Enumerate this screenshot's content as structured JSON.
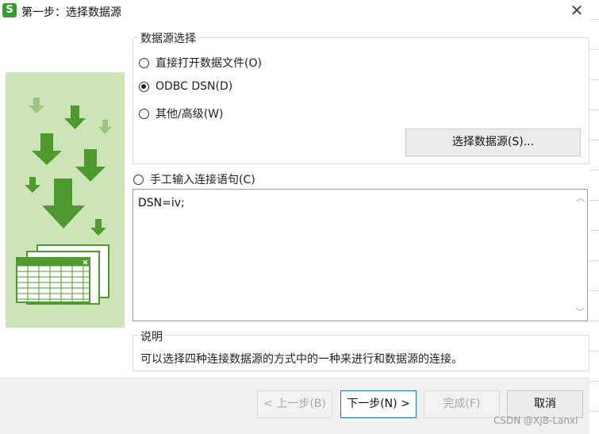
{
  "window": {
    "app_icon_letter": "S",
    "title": "第一步：选择数据源",
    "close_glyph": "✕"
  },
  "datasource_group": {
    "legend": "数据源选择",
    "options": [
      {
        "label": "直接打开数据文件(O)",
        "checked": false
      },
      {
        "label": "ODBC DSN(D)",
        "checked": true
      },
      {
        "label": "其他/高级(W)",
        "checked": false
      }
    ],
    "choose_button": "选择数据源(S)..."
  },
  "manual": {
    "label": "手工输入连接语句(C)",
    "checked": false,
    "text": "DSN=iv;"
  },
  "description": {
    "legend": "说明",
    "text": "可以选择四种连接数据源的方式中的一种来进行和数据源的连接。"
  },
  "buttons": {
    "prev": "< 上一步(B)",
    "next": "下一步(N) >",
    "finish": "完成(F)",
    "cancel": "取消"
  },
  "watermark": "CSDN @XJB-Lanxi",
  "icons": {
    "side_art": "download-arrows-spreadsheet-icon",
    "close": "close-icon",
    "scroll_up": "scroll-up-icon",
    "scroll_down": "scroll-down-icon"
  },
  "colors": {
    "accent": "#1a73c9",
    "illustration_bg": "#cde4b8",
    "illustration_green": "#4f9a2e"
  }
}
